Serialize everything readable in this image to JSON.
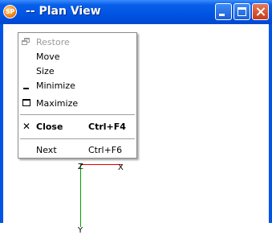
{
  "window": {
    "title": "-- Plan View",
    "app_icon_text": "SP"
  },
  "menu": {
    "items": [
      {
        "label": "Restore",
        "shortcut": "",
        "icon": "restore-icon",
        "disabled": true
      },
      {
        "label": "Move",
        "shortcut": "",
        "icon": "",
        "disabled": false
      },
      {
        "label": "Size",
        "shortcut": "",
        "icon": "",
        "disabled": false
      },
      {
        "label": "Minimize",
        "shortcut": "",
        "icon": "minimize-icon",
        "disabled": false
      },
      {
        "label": "Maximize",
        "shortcut": "",
        "icon": "maximize-icon",
        "disabled": false
      },
      {
        "label": "Close",
        "shortcut": "Ctrl+F4",
        "icon": "close-icon",
        "disabled": false,
        "bold": true
      },
      {
        "label": "Next",
        "shortcut": "Ctrl+F6",
        "icon": "",
        "disabled": false
      }
    ]
  },
  "canvas": {
    "axis_labels": {
      "z": "Z",
      "x": "X",
      "y": "Y"
    }
  },
  "colors": {
    "titlebar": "#0055e5",
    "x_axis": "#e00000",
    "y_axis": "#00a000",
    "disabled_text": "#9b9b9b"
  }
}
